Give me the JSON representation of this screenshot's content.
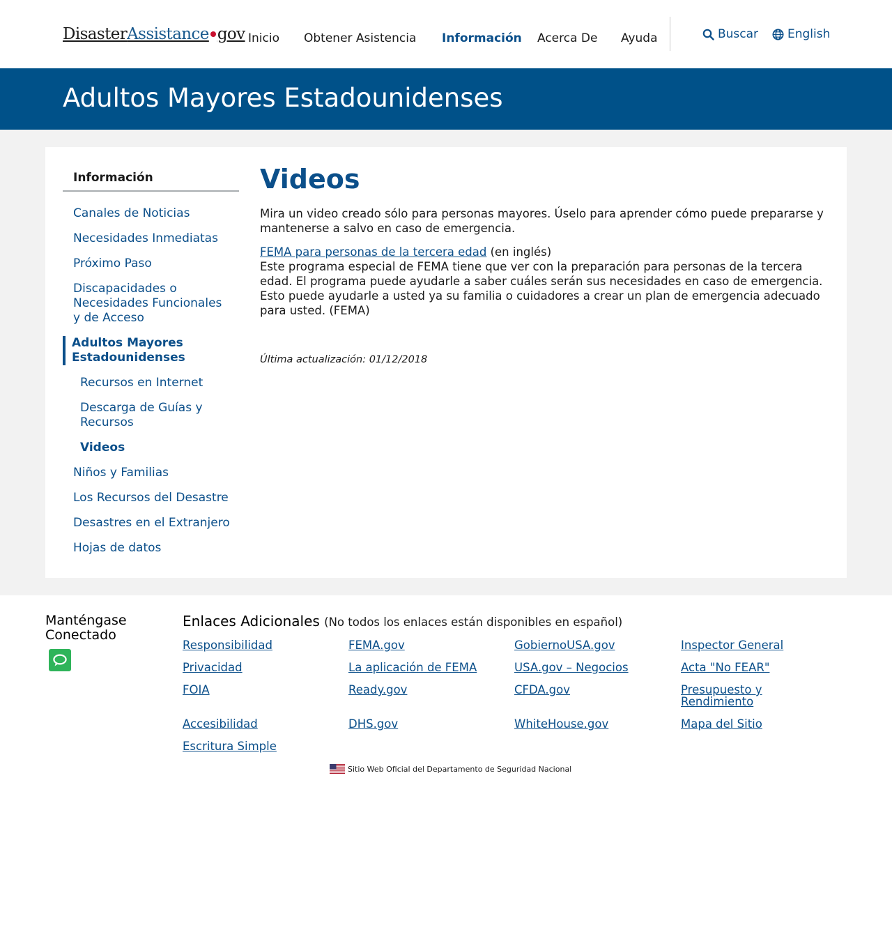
{
  "header": {
    "logo": {
      "part1": "Disaster",
      "part2": "Assistance",
      "part3": "gov"
    },
    "nav": [
      {
        "label": "Inicio"
      },
      {
        "label": "Obtener Asistencia"
      },
      {
        "label": "Información",
        "active": true
      },
      {
        "label": "Acerca De"
      },
      {
        "label": "Ayuda"
      }
    ],
    "search_label": "Buscar",
    "language_label": "English"
  },
  "banner": {
    "title": "Adultos Mayores Estadounidenses"
  },
  "sidebar": {
    "heading": "Información",
    "items": [
      {
        "label": "Canales de Noticias"
      },
      {
        "label": "Necesidades Inmediatas"
      },
      {
        "label": "Próximo Paso"
      },
      {
        "label": "Discapacidades o Necesidades Funcionales y de Acceso"
      },
      {
        "label": "Adultos Mayores Estadounidenses",
        "current": true
      },
      {
        "label": "Recursos en Internet",
        "sub": true
      },
      {
        "label": "Descarga de Guías y Recursos",
        "sub": true
      },
      {
        "label": "Videos",
        "sub": true,
        "active": true
      },
      {
        "label": "Niños y Familias"
      },
      {
        "label": "Los Recursos del Desastre"
      },
      {
        "label": "Desastres en el Extranjero"
      },
      {
        "label": "Hojas de datos"
      }
    ]
  },
  "main": {
    "title": "Videos",
    "intro": "Mira un video creado sólo para personas mayores. Úselo para aprender cómo puede prepararse y mantenerse a salvo en caso de emergencia.",
    "video_link": "FEMA para personas de la tercera edad",
    "video_suffix": " (en inglés)",
    "video_description": "Este programa especial de FEMA tiene que ver con la preparación para personas de la tercera edad. El programa puede ayudarle a saber cuáles serán sus necesidades en caso de emergencia. Esto puede ayudarle a usted ya su familia o cuidadores a crear un plan de emergencia adecuado para usted. (FEMA)",
    "updated": "Última actualización: 01/12/2018"
  },
  "footer": {
    "connected_title": "Manténgase Conectado",
    "links_title": "Enlaces Adicionales",
    "links_note": "(No todos los enlaces están disponibles en español)",
    "columns": [
      [
        "Responsibilidad",
        "Privacidad",
        "FOIA",
        "Accesibilidad",
        "Escritura Simple"
      ],
      [
        "FEMA.gov",
        "La aplicación de FEMA",
        "Ready.gov",
        "DHS.gov"
      ],
      [
        "GobiernoUSA.gov",
        "USA.gov – Negocios",
        "CFDA.gov",
        "WhiteHouse.gov"
      ],
      [
        "Inspector General",
        "Acta \"No FEAR\"",
        "Presupuesto y Rendimiento",
        "Mapa del Sitio"
      ]
    ],
    "official_site": "Sitio Web Oficial del Departamento de Seguridad Nacional"
  },
  "colors": {
    "banner": "#005189",
    "link": "#0b4f8a",
    "logo_dot": "#c8102e",
    "chat_icon": "#2fb45a",
    "page_background": "#f2f2f2"
  },
  "icons": {
    "search": "search-icon",
    "language": "globe-icon",
    "chat": "chat-icon",
    "flag": "us-flag-icon"
  }
}
